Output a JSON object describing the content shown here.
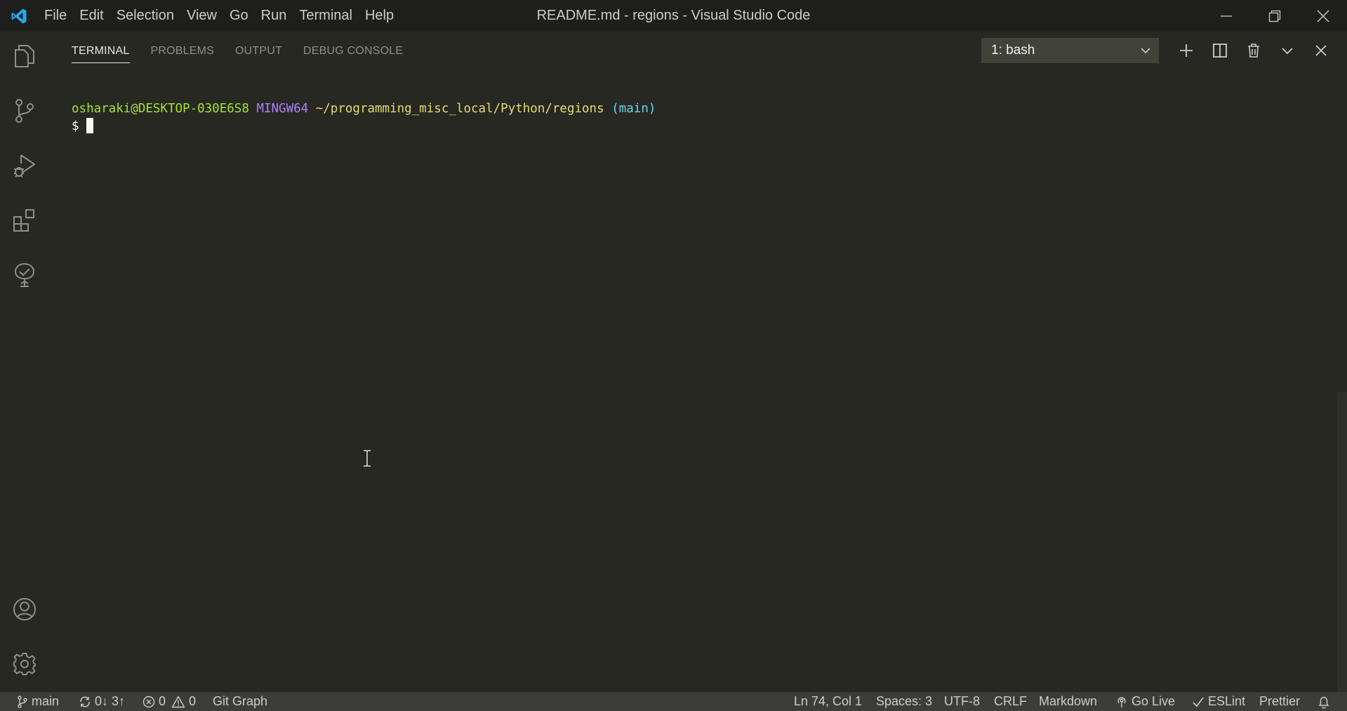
{
  "titlebar": {
    "menu": [
      "File",
      "Edit",
      "Selection",
      "View",
      "Go",
      "Run",
      "Terminal",
      "Help"
    ],
    "window_title": "README.md - regions - Visual Studio Code"
  },
  "activitybar": {
    "items": [
      "explorer-icon",
      "source-control-icon",
      "run-debug-icon",
      "extensions-icon",
      "remote-tree-icon"
    ],
    "bottom": [
      "account-icon",
      "settings-gear-icon"
    ]
  },
  "panel": {
    "tabs": [
      "TERMINAL",
      "PROBLEMS",
      "OUTPUT",
      "DEBUG CONSOLE"
    ],
    "active_tab": "TERMINAL",
    "terminal_select": "1: bash"
  },
  "terminal": {
    "user": "osharaki@DESKTOP-030E6S8",
    "system": "MINGW64",
    "path": "~/programming_misc_local/Python/regions",
    "branch": "(main)",
    "prompt": "$"
  },
  "statusbar": {
    "branch": "main",
    "sync": "0↓ 3↑",
    "errors": "0",
    "warnings": "0",
    "git_graph": "Git Graph",
    "position": "Ln 74, Col 1",
    "spaces": "Spaces: 3",
    "encoding": "UTF-8",
    "eol": "CRLF",
    "language": "Markdown",
    "go_live": "Go Live",
    "eslint": "ESLint",
    "prettier": "Prettier"
  },
  "colors": {
    "background": "#272822",
    "titlebar": "#1e1f1c",
    "statusbar": "#3c3d38",
    "vscode_blue": "#23a9f2"
  }
}
